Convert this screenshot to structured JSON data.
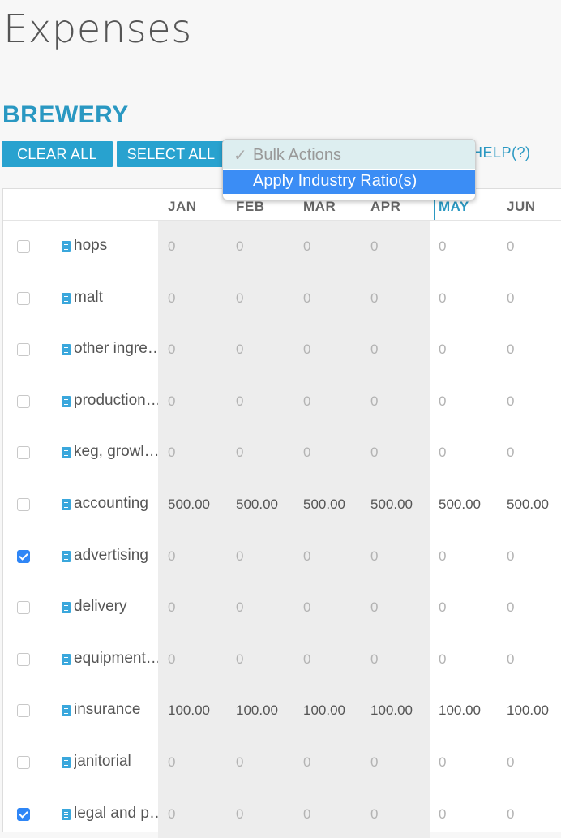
{
  "page": {
    "title": "Expenses"
  },
  "section": {
    "title": "BREWERY"
  },
  "toolbar": {
    "clear_all": "CLEAR ALL",
    "select_all": "SELECT ALL",
    "help": "HELP(?)"
  },
  "bulk_actions": {
    "selected": "Bulk Actions",
    "options": [
      "Apply Industry Ratio(s)"
    ]
  },
  "table": {
    "months": [
      "JAN",
      "FEB",
      "MAR",
      "APR",
      "MAY",
      "JUN"
    ],
    "active_month": "MAY",
    "rows": [
      {
        "label": "hops",
        "checked": false,
        "values": [
          "0",
          "0",
          "0",
          "0",
          "0",
          "0"
        ]
      },
      {
        "label": "malt",
        "checked": false,
        "values": [
          "0",
          "0",
          "0",
          "0",
          "0",
          "0"
        ]
      },
      {
        "label": "other ingre…",
        "checked": false,
        "values": [
          "0",
          "0",
          "0",
          "0",
          "0",
          "0"
        ]
      },
      {
        "label": "production…",
        "checked": false,
        "values": [
          "0",
          "0",
          "0",
          "0",
          "0",
          "0"
        ]
      },
      {
        "label": "keg, growl…",
        "checked": false,
        "values": [
          "0",
          "0",
          "0",
          "0",
          "0",
          "0"
        ]
      },
      {
        "label": "accounting",
        "checked": false,
        "values": [
          "500.00",
          "500.00",
          "500.00",
          "500.00",
          "500.00",
          "500.00"
        ]
      },
      {
        "label": "advertising",
        "checked": true,
        "values": [
          "0",
          "0",
          "0",
          "0",
          "0",
          "0"
        ]
      },
      {
        "label": "delivery",
        "checked": false,
        "values": [
          "0",
          "0",
          "0",
          "0",
          "0",
          "0"
        ]
      },
      {
        "label": "equipment…",
        "checked": false,
        "values": [
          "0",
          "0",
          "0",
          "0",
          "0",
          "0"
        ]
      },
      {
        "label": "insurance",
        "checked": false,
        "values": [
          "100.00",
          "100.00",
          "100.00",
          "100.00",
          "100.00",
          "100.00"
        ]
      },
      {
        "label": "janitorial",
        "checked": false,
        "values": [
          "0",
          "0",
          "0",
          "0",
          "0",
          "0"
        ]
      },
      {
        "label": "legal and p…",
        "checked": true,
        "values": [
          "0",
          "0",
          "0",
          "0",
          "0",
          "0"
        ]
      }
    ]
  },
  "colors": {
    "accent": "#28a2cf",
    "checkbox_checked": "#2f86f6",
    "dropdown_highlight": "#3b8df5"
  },
  "icons": {
    "row_icon": "document-icon",
    "dropdown_check": "checkmark-icon"
  }
}
